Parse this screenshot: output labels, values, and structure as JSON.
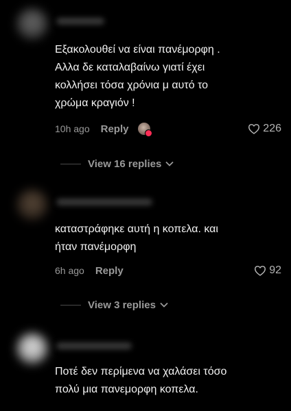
{
  "comments": [
    {
      "text": "Εξακολουθεί να είναι πανέμορφη .\nΑλλα δε καταλαβαίνω γιατί έχει\nκολλήσει τόσα χρόνια μ αυτό το\nχρώμα κραγιόν !",
      "time": "10h ago",
      "reply_label": "Reply",
      "likes": "226",
      "view_replies": "View 16 replies"
    },
    {
      "text": "καταστράφηκε αυτή η κοπελα. και\nήταν πανέμορφη",
      "time": "6h ago",
      "reply_label": "Reply",
      "likes": "92",
      "view_replies": "View 3 replies"
    },
    {
      "text": "Ποτέ δεν περίμενα να χαλάσει τόσο\nπολύ μια πανεμορφη κοπελα."
    }
  ],
  "colors": {
    "background": "#000000",
    "text": "#f2f2f2",
    "muted": "#9a9a9a",
    "badge": "#fe2c55"
  },
  "icons": {
    "like": "heart-outline-icon",
    "expand": "chevron-down-icon"
  }
}
